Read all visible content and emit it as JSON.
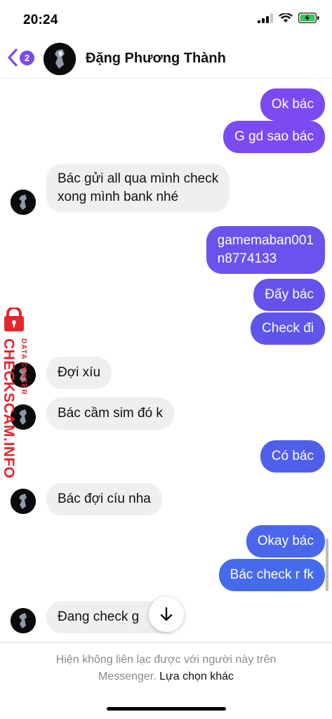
{
  "status_bar": {
    "time": "20:24",
    "battery": "charging"
  },
  "header": {
    "back_badge": "2",
    "contact_name": "Đặng Phương Thành"
  },
  "colors": {
    "accent": "#7b4af0",
    "bubble_purple": "#7b4af0",
    "bubble_indigo": "#5b55e8",
    "bubble_blue": "#4a68ec",
    "incoming_bubble": "#efefef"
  },
  "messages": [
    {
      "from": "me",
      "text": "Ok bác"
    },
    {
      "from": "me",
      "text": "G gd sao bác"
    },
    {
      "from": "them",
      "line1": "Bác gửi all qua mình check",
      "line2": "xong mình bank nhé"
    },
    {
      "from": "me",
      "line1": "gamemaban001",
      "line2": "n8774133"
    },
    {
      "from": "me",
      "text": "Đấy bác"
    },
    {
      "from": "me",
      "text": "Check đi"
    },
    {
      "from": "them",
      "text": "Đợi xíu"
    },
    {
      "from": "them",
      "text": "Bác cầm sim đó k"
    },
    {
      "from": "me",
      "text": "Có bác"
    },
    {
      "from": "them",
      "text": "Bác đợi cíu nha"
    },
    {
      "from": "me",
      "text": "Okay bác"
    },
    {
      "from": "me",
      "text": "Bác check r fk"
    },
    {
      "from": "them",
      "text": "Đang check g"
    }
  ],
  "watermark": {
    "brand": "CHECKSCAM.INFO",
    "sub": "DATA CENTER"
  },
  "footer": {
    "notice_line1": "Hiện không liên lạc được với người này trên",
    "notice_line2_prefix": "Messenger.",
    "notice_link": "Lựa chọn khác"
  }
}
